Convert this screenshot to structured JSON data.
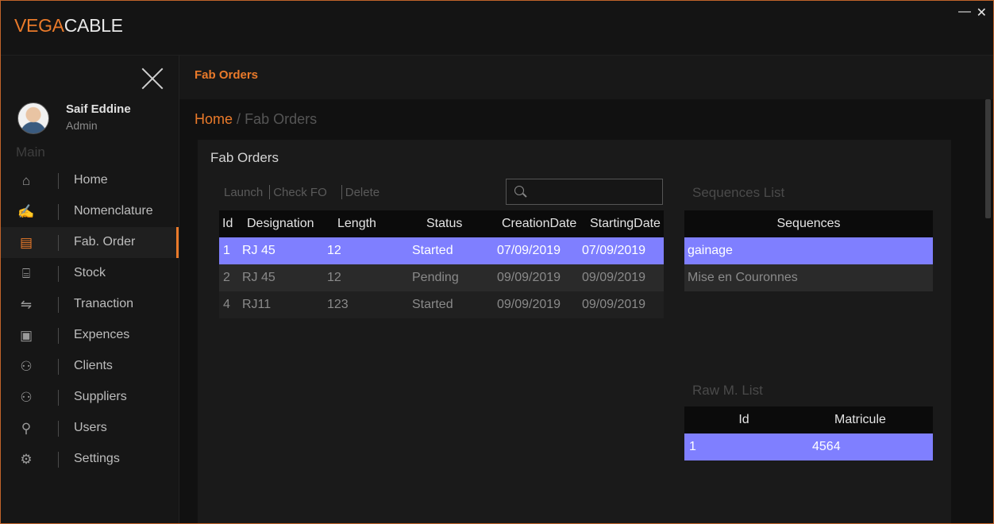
{
  "app": {
    "brand_part1": "VEGA",
    "brand_part2": "CABLE",
    "minimize_glyph": "—",
    "close_glyph": "✕"
  },
  "colors": {
    "accent": "#ea7a2a",
    "selection": "#7f7fff"
  },
  "user": {
    "name": "Saif Eddine",
    "role": "Admin"
  },
  "sidebar": {
    "section_label": "Main",
    "items": [
      {
        "label": "Home",
        "icon": "home-icon",
        "glyph": "⌂"
      },
      {
        "label": "Nomenclature",
        "icon": "handshake-pen-icon",
        "glyph": "✍"
      },
      {
        "label": "Fab. Order",
        "icon": "order-document-icon",
        "glyph": "▤"
      },
      {
        "label": "Stock",
        "icon": "store-icon",
        "glyph": "⌸"
      },
      {
        "label": "Tranaction",
        "icon": "handshake-icon",
        "glyph": "⇋"
      },
      {
        "label": "Expences",
        "icon": "money-icon",
        "glyph": "▣"
      },
      {
        "label": "Clients",
        "icon": "users-icon",
        "glyph": "⚇"
      },
      {
        "label": "Suppliers",
        "icon": "users-icon",
        "glyph": "⚇"
      },
      {
        "label": "Users",
        "icon": "user-icon",
        "glyph": "⚲"
      },
      {
        "label": "Settings",
        "icon": "gear-icon",
        "glyph": "⚙"
      }
    ]
  },
  "header": {
    "title": "Fab Orders"
  },
  "breadcrumb": {
    "home": "Home",
    "separator": "/",
    "current": "Fab Orders"
  },
  "card": {
    "title": "Fab Orders",
    "actions": {
      "launch": "Launch",
      "check": "Check FO",
      "delete": "Delete"
    },
    "search_placeholder": ""
  },
  "orders_table": {
    "columns": [
      "Id",
      "Designation",
      "Length",
      "Status",
      "CreationDate",
      "StartingDate"
    ],
    "rows": [
      [
        "1",
        "RJ 45",
        "12",
        "Started",
        "07/09/2019",
        "07/09/2019"
      ],
      [
        "2",
        "RJ 45",
        "12",
        "Pending",
        "09/09/2019",
        "09/09/2019"
      ],
      [
        "4",
        "RJ11",
        "123",
        "Started",
        "09/09/2019",
        "09/09/2019"
      ]
    ]
  },
  "sequences": {
    "title": "Sequences List",
    "column": "Sequences",
    "rows": [
      "gainage",
      "Mise en Couronnes"
    ]
  },
  "raw_materials": {
    "title": "Raw M. List",
    "columns": [
      "Id",
      "Matricule"
    ],
    "rows": [
      [
        "1",
        "4564"
      ]
    ]
  }
}
